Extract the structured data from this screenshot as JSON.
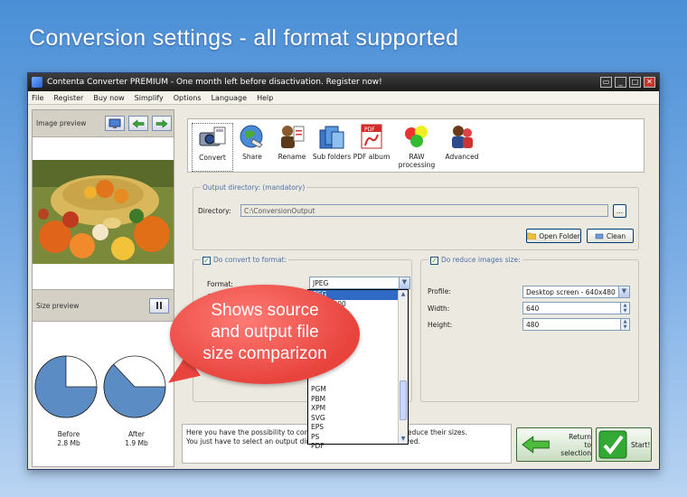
{
  "headline": "Conversion settings -  all format supported",
  "window": {
    "title": "Contenta Converter PREMIUM  - One month left before disactivation. Register now!",
    "controls": [
      "▭",
      "_",
      "□",
      "✕"
    ]
  },
  "menu": [
    "File",
    "Register",
    "Buy now",
    "Simplify",
    "Options",
    "Language",
    "Help"
  ],
  "left": {
    "image_preview_label": "Image preview",
    "size_preview_label": "Size preview",
    "before_label": "Before",
    "before_value": "2.8 Mb",
    "after_label": "After",
    "after_value": "1.9 Mb",
    "before_fraction": 0.75,
    "after_fraction": 0.63
  },
  "toolbar": [
    {
      "label": "Convert",
      "icon": "convert-icon"
    },
    {
      "label": "Share",
      "icon": "share-globe-icon"
    },
    {
      "label": "Rename",
      "icon": "rename-icon"
    },
    {
      "label": "Sub folders",
      "icon": "subfolders-icon"
    },
    {
      "label": "PDF album",
      "icon": "pdf-icon"
    },
    {
      "label": "RAW processing",
      "icon": "raw-icon"
    },
    {
      "label": "Advanced",
      "icon": "advanced-icon"
    }
  ],
  "output": {
    "group_title": "Output directory: (mandatory)",
    "directory_label": "Directory:",
    "directory_value": "C:\\ConversionOutput",
    "browse_label": "...",
    "open_folder_label": "Open Folder",
    "clean_label": "Clean"
  },
  "convert": {
    "group_title": "Do convert to format:",
    "format_label": "Format:",
    "format_value": "JPEG",
    "partial_label": "Q",
    "options": [
      "JPEG",
      "JPEG 2000",
      "",
      "",
      "",
      "",
      "",
      "",
      "",
      "",
      "PGM",
      "PBM",
      "XPM",
      "SVG",
      "EPS",
      "PS",
      "PDF"
    ]
  },
  "resize": {
    "group_title": "Do reduce images size:",
    "profile_label": "Profile:",
    "profile_value": "Desktop screen - 640x480",
    "width_label": "Width:",
    "width_value": "640",
    "height_label": "Height:",
    "height_value": "480"
  },
  "bubble": {
    "lines": [
      "Shows source",
      "and output file",
      "size comparizon"
    ]
  },
  "info": {
    "line1": "Here you have the possibility to convert",
    "line1b": "mat and to reduce their sizes.",
    "line2": "You just have to select an output directo",
    "line2b": "will be saved."
  },
  "buttons": {
    "return_label": "Return",
    "return_label2": "to selection",
    "start_label": "Start!"
  },
  "colors": {
    "pie_fill": "#5b8cc4",
    "accent": "#316ac5",
    "bubble": "#e8433d"
  }
}
